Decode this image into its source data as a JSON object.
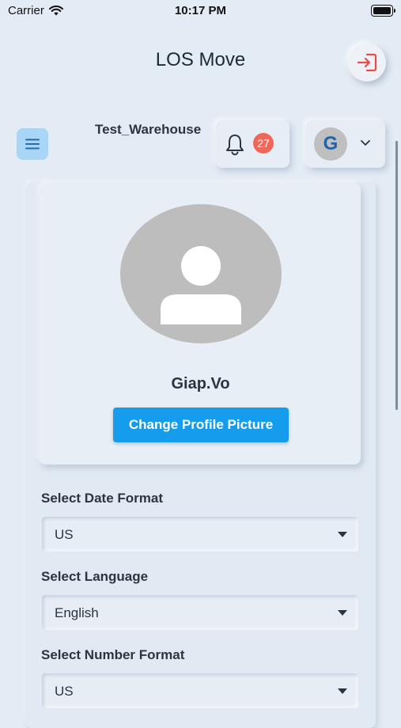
{
  "status_bar": {
    "carrier": "Carrier",
    "time": "10:17 PM"
  },
  "header": {
    "title": "LOS Move",
    "logout_icon": "logout-icon"
  },
  "toolbar": {
    "warehouse": "Test_Warehouse",
    "notifications_count": "27",
    "user_initial": "G"
  },
  "profile": {
    "username": "Giap.Vo",
    "change_picture_label": "Change Profile Picture"
  },
  "settings": {
    "date_format": {
      "label": "Select Date Format",
      "value": "US"
    },
    "language": {
      "label": "Select Language",
      "value": "English"
    },
    "number_format": {
      "label": "Select Number Format",
      "value": "US"
    }
  },
  "colors": {
    "accent": "#159cec",
    "badge": "#f0675a",
    "logout": "#e84a4a",
    "background": "#e3ebf4"
  }
}
